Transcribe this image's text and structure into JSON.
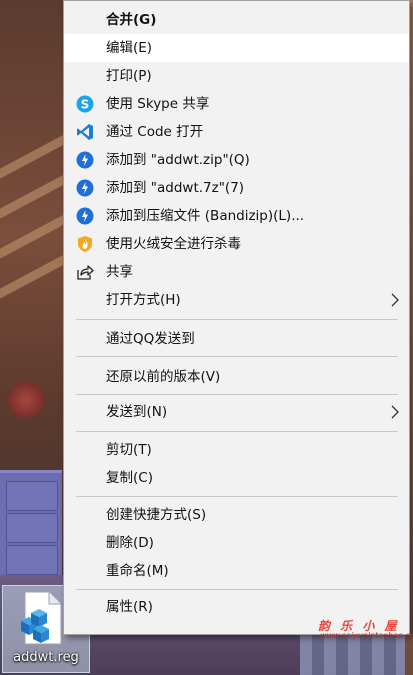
{
  "desktop": {
    "file": {
      "name": "addwt.reg",
      "icon": "registry-file-icon"
    }
  },
  "menu": {
    "items": [
      {
        "label": "合并(G)",
        "bold": true,
        "icon": ""
      },
      {
        "label": "编辑(E)",
        "icon": "",
        "hover": true
      },
      {
        "label": "打印(P)",
        "icon": ""
      },
      {
        "label": "使用 Skype 共享",
        "icon": "skype-icon"
      },
      {
        "label": "通过 Code 打开",
        "icon": "vscode-icon"
      },
      {
        "label": "添加到 \"addwt.zip\"(Q)",
        "icon": "bandizip-icon"
      },
      {
        "label": "添加到 \"addwt.7z\"(7)",
        "icon": "bandizip-icon"
      },
      {
        "label": "添加到压缩文件 (Bandizip)(L)...",
        "icon": "bandizip-icon"
      },
      {
        "label": "使用火绒安全进行杀毒",
        "icon": "huorong-shield-icon"
      },
      {
        "label": "共享",
        "icon": "share-icon"
      },
      {
        "label": "打开方式(H)",
        "icon": "",
        "submenu": true
      },
      {
        "label": "通过QQ发送到",
        "icon": ""
      },
      {
        "label": "还原以前的版本(V)",
        "icon": ""
      },
      {
        "label": "发送到(N)",
        "icon": "",
        "submenu": true
      },
      {
        "label": "剪切(T)",
        "icon": ""
      },
      {
        "label": "复制(C)",
        "icon": ""
      },
      {
        "label": "创建快捷方式(S)",
        "icon": ""
      },
      {
        "label": "删除(D)",
        "icon": ""
      },
      {
        "label": "重命名(M)",
        "icon": ""
      },
      {
        "label": "属性(R)",
        "icon": ""
      }
    ]
  },
  "watermark": {
    "line1": "韵 乐 小 屋",
    "line2": "www.saiyunletaobao.com"
  },
  "colors": {
    "menu_bg": "#f2f2f2",
    "hover_bg": "#ffffff",
    "bandizip_blue": "#1e6fd9",
    "skype_blue": "#1aa5e8",
    "vscode_blue": "#1f7fd0"
  }
}
